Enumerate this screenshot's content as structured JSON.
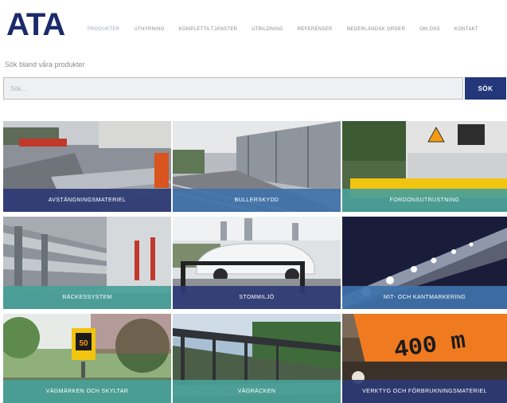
{
  "header": {
    "logo_text": "ATA",
    "nav": [
      {
        "label": "PRODUKTER",
        "active": true
      },
      {
        "label": "UTHYRNING",
        "active": false
      },
      {
        "label": "KOMPLETTA TJÄNSTER",
        "active": false
      },
      {
        "label": "UTBILDNING",
        "active": false
      },
      {
        "label": "REFERENSER",
        "active": false
      },
      {
        "label": "NEDERLÄNDSK ORDER",
        "active": false
      },
      {
        "label": "OM OSS",
        "active": false
      },
      {
        "label": "KONTAKT",
        "active": false
      }
    ]
  },
  "search": {
    "label": "Sök bland våra produkter",
    "placeholder": "Sök...",
    "button_label": "SÖK"
  },
  "tiles": [
    {
      "label": "AVSTÄNGNINGSMATERIEL",
      "label_color": "navy",
      "icon": "road-barrier-photo"
    },
    {
      "label": "BULLERSKYDD",
      "label_color": "blue",
      "icon": "noise-barrier-photo"
    },
    {
      "label": "FORDONSUTRUSTNING",
      "label_color": "teal",
      "icon": "truck-equipment-photo"
    },
    {
      "label": "RÄCKESSYSTEM",
      "label_color": "teal",
      "icon": "guardrail-photo"
    },
    {
      "label": "STOMMILJÖ",
      "label_color": "navy",
      "icon": "car-urban-photo"
    },
    {
      "label": "MIT- OCH KANTMARKERING",
      "label_color": "blue",
      "icon": "road-markers-photo"
    },
    {
      "label": "VÄGMÄRKEN OCH SKYLTAR",
      "label_color": "teal",
      "icon": "traffic-sign-photo"
    },
    {
      "label": "VÄGRÄCKEN",
      "label_color": "teal",
      "icon": "roadside-rail-photo"
    },
    {
      "label": "VERKTYG OCH FÖRBRUKNINGSMATERIEL",
      "label_color": "navy",
      "icon": "tools-sign-photo"
    }
  ],
  "tile_sign_texts": {
    "sign_value": "50",
    "distance_sign": "400 m"
  },
  "colors": {
    "brand_navy": "#1b2a6b",
    "button": "#24377a",
    "label_navy": "#2c3a74",
    "label_blue": "#3e72aa",
    "label_teal": "#48a098"
  }
}
